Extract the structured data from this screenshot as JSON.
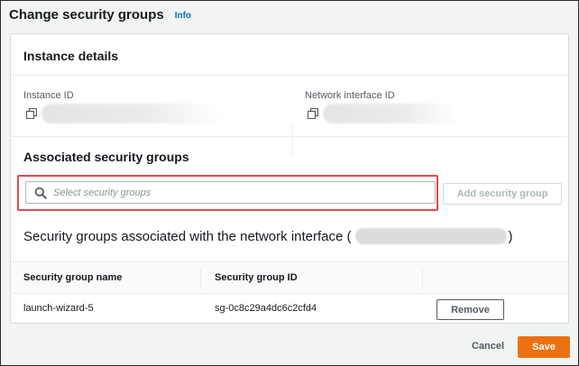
{
  "header": {
    "title": "Change security groups",
    "info_link": "Info"
  },
  "instance_details": {
    "heading": "Instance details",
    "instance_id_label": "Instance ID",
    "network_interface_id_label": "Network interface ID"
  },
  "associated": {
    "heading": "Associated security groups",
    "search_placeholder": "Select security groups",
    "add_button": "Add security group",
    "network_interface_text": "Security groups associated with the network interface (",
    "network_interface_close": ")"
  },
  "table": {
    "columns": [
      "Security group name",
      "Security group ID"
    ],
    "rows": [
      {
        "name": "launch-wizard-5",
        "id": "sg-0c8c29a4dc6c2cfd4",
        "action": "Remove"
      }
    ]
  },
  "footer": {
    "cancel": "Cancel",
    "save": "Save"
  },
  "colors": {
    "primary": "#ec7211",
    "link": "#0073bb",
    "highlight": "#e5484d"
  }
}
